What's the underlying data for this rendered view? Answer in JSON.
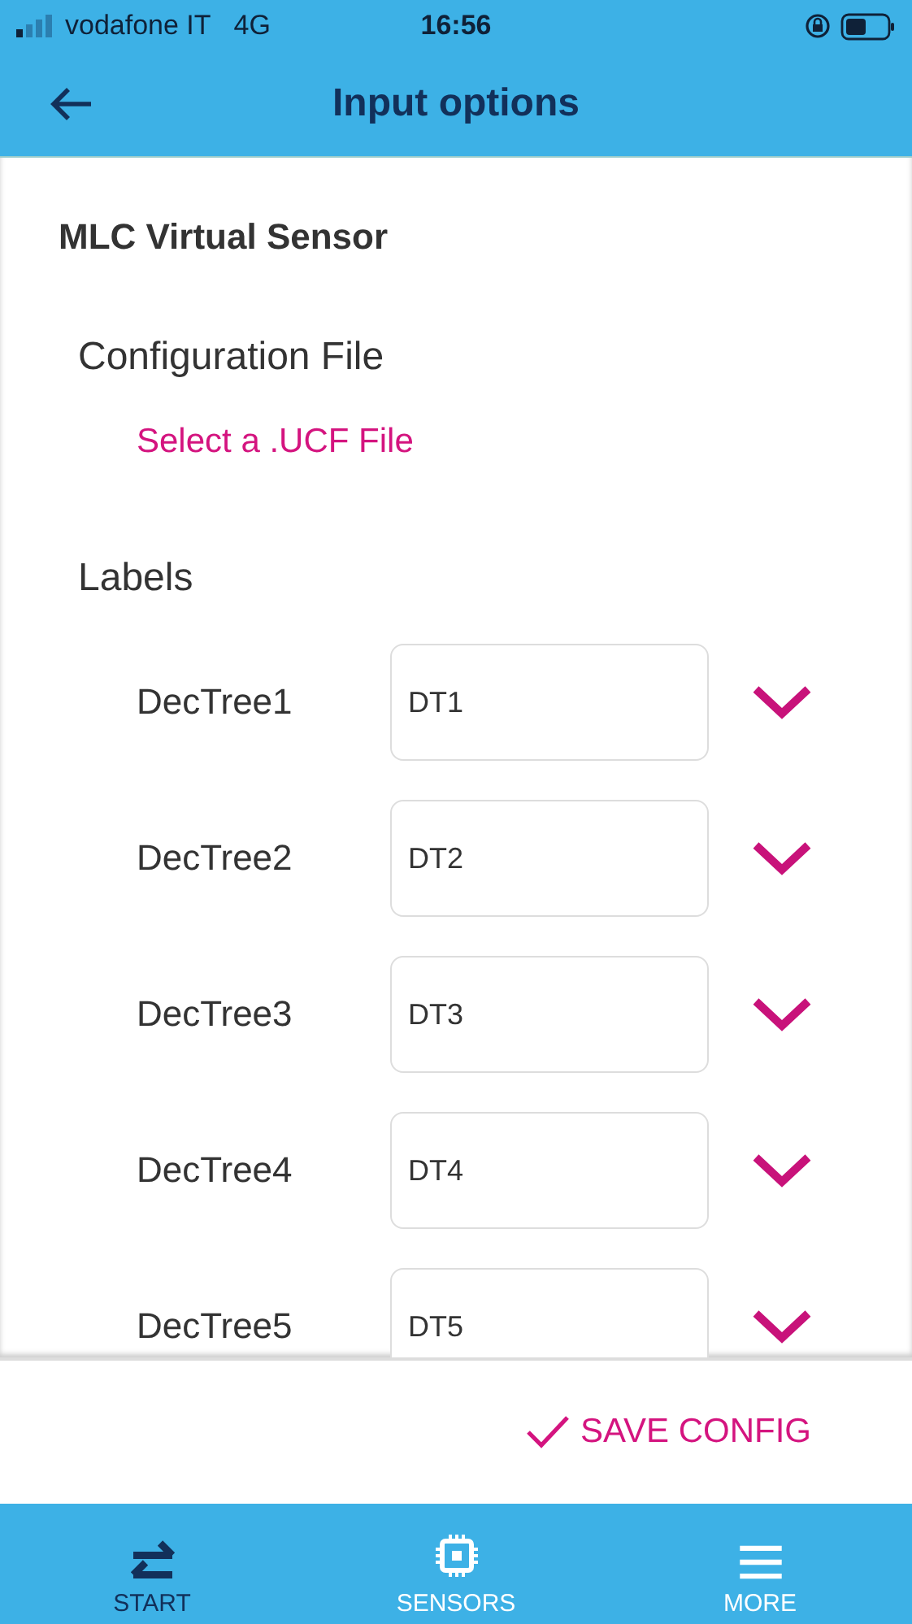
{
  "status_bar": {
    "carrier": "vodafone IT",
    "network": "4G",
    "time": "16:56"
  },
  "header": {
    "title": "Input options"
  },
  "section_title": "MLC Virtual Sensor",
  "configuration": {
    "heading": "Configuration File",
    "link": "Select a .UCF File"
  },
  "labels": {
    "heading": "Labels",
    "rows": [
      {
        "name": "DecTree1",
        "value": "DT1"
      },
      {
        "name": "DecTree2",
        "value": "DT2"
      },
      {
        "name": "DecTree3",
        "value": "DT3"
      },
      {
        "name": "DecTree4",
        "value": "DT4"
      },
      {
        "name": "DecTree5",
        "value": "DT5"
      }
    ]
  },
  "save_button": "SAVE CONFIG",
  "tabs": [
    {
      "label": "START",
      "kind": "swap",
      "selected": true
    },
    {
      "label": "SENSORS",
      "kind": "chip",
      "selected": false
    },
    {
      "label": "MORE",
      "kind": "menu",
      "selected": false
    }
  ]
}
